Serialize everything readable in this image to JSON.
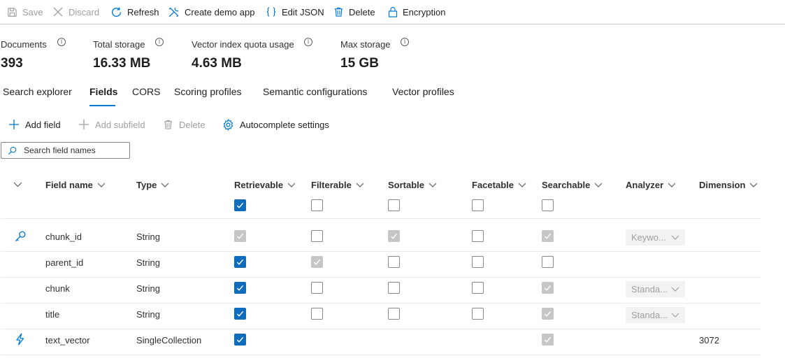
{
  "toolbar": {
    "save": "Save",
    "discard": "Discard",
    "refresh": "Refresh",
    "create_demo_app": "Create demo app",
    "edit_json": "Edit JSON",
    "delete": "Delete",
    "encryption": "Encryption"
  },
  "metrics": [
    {
      "label": "Documents",
      "value": "393"
    },
    {
      "label": "Total storage",
      "value": "16.33 MB"
    },
    {
      "label": "Vector index quota usage",
      "value": "4.63 MB"
    },
    {
      "label": "Max storage",
      "value": "15 GB"
    }
  ],
  "tabs": [
    {
      "label": "Search explorer",
      "active": false
    },
    {
      "label": "Fields",
      "active": true
    },
    {
      "label": "CORS",
      "active": false
    },
    {
      "label": "Scoring profiles",
      "active": false
    },
    {
      "label": "Semantic configurations",
      "active": false
    },
    {
      "label": "Vector profiles",
      "active": false
    }
  ],
  "commands": {
    "add_field": "Add field",
    "add_subfield": "Add subfield",
    "delete": "Delete",
    "autocomplete": "Autocomplete settings"
  },
  "search": {
    "placeholder": "Search field names"
  },
  "columns": {
    "field_name": "Field name",
    "type": "Type",
    "retrievable": "Retrievable",
    "filterable": "Filterable",
    "sortable": "Sortable",
    "facetable": "Facetable",
    "searchable": "Searchable",
    "analyzer": "Analyzer",
    "dimension": "Dimension"
  },
  "header_checks": {
    "retrievable": "checked",
    "filterable": "unchecked",
    "sortable": "unchecked",
    "facetable": "unchecked",
    "searchable": "unchecked"
  },
  "rows": [
    {
      "icon": "key-icon",
      "name": "chunk_id",
      "type": "String",
      "retrievable": "disabled-checked",
      "filterable": "unchecked",
      "sortable": "disabled-checked",
      "facetable": "unchecked",
      "searchable": "disabled-checked",
      "analyzer": "Keywo...",
      "dimension": ""
    },
    {
      "icon": "",
      "name": "parent_id",
      "type": "String",
      "retrievable": "checked",
      "filterable": "disabled-checked",
      "sortable": "unchecked",
      "facetable": "unchecked",
      "searchable": "unchecked",
      "analyzer": "",
      "dimension": ""
    },
    {
      "icon": "",
      "name": "chunk",
      "type": "String",
      "retrievable": "checked",
      "filterable": "unchecked",
      "sortable": "unchecked",
      "facetable": "unchecked",
      "searchable": "disabled-checked",
      "analyzer": "Standa...",
      "dimension": ""
    },
    {
      "icon": "",
      "name": "title",
      "type": "String",
      "retrievable": "checked",
      "filterable": "unchecked",
      "sortable": "unchecked",
      "facetable": "unchecked",
      "searchable": "disabled-checked",
      "analyzer": "Standa...",
      "dimension": ""
    },
    {
      "icon": "lightning-icon",
      "name": "text_vector",
      "type": "SingleCollection",
      "retrievable": "checked",
      "filterable": "",
      "sortable": "",
      "facetable": "",
      "searchable": "disabled-checked",
      "analyzer": "",
      "dimension": "3072"
    }
  ],
  "colors": {
    "accent": "#0078d4",
    "checkbox": "#0f6cbd",
    "disabled": "#c8c6c4"
  }
}
